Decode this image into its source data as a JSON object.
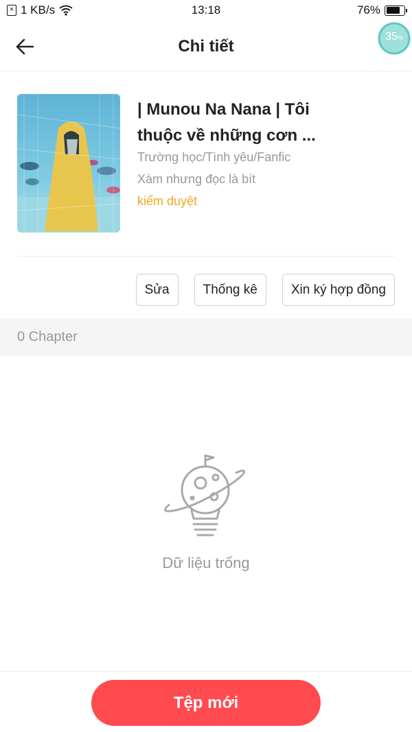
{
  "status_bar": {
    "sim_icon": "sim-x-icon",
    "network_speed": "1 KB/s",
    "wifi_icon": "wifi-icon",
    "time": "13:18",
    "battery_percent": "76%",
    "battery_level": 0.76
  },
  "header": {
    "back_icon": "arrow-left-icon",
    "title": "Chi tiết",
    "progress_value": "35",
    "progress_unit": "%",
    "accent": "#5cc8c2"
  },
  "book": {
    "title": "| Munou Na Nana | Tôi thuộc về những cơn ...",
    "genre": "Trường học/Tình yêu/Fanfic",
    "description": "Xàm nhưng đọc là bít",
    "status": "kiểm duyệt",
    "status_color": "#f5a623"
  },
  "actions": {
    "edit": "Sửa",
    "stats": "Thống kê",
    "contract": "Xin ký hợp đồng"
  },
  "chapters": {
    "count_label": "0 Chapter"
  },
  "empty_state": {
    "icon": "lightbulb-planet-icon",
    "text": "Dữ liệu trống"
  },
  "bottom": {
    "new_file_label": "Tệp mới",
    "button_color": "#ff4a4f"
  }
}
